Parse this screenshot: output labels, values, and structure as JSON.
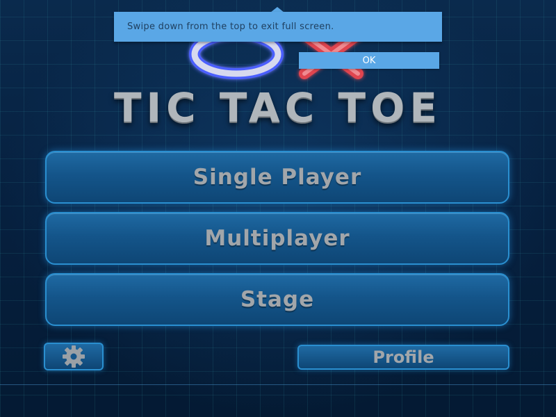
{
  "title": "TIC TAC TOE",
  "logo_icon": "ox-logo",
  "menu": {
    "single_player": "Single Player",
    "multiplayer": "Multiplayer",
    "stage": "Stage"
  },
  "footer": {
    "settings_icon": "gear-icon",
    "profile_label": "Profile"
  },
  "toast": {
    "message": "Swipe down from the top to exit full screen.",
    "ok_label": "OK"
  },
  "colors": {
    "background": "#061a33",
    "button_fill": "#14558a",
    "button_border": "#2a8fd0",
    "button_text": "#a2a6aa",
    "toast_bg": "#5aa7e6",
    "logo_o": "#d7d9ee",
    "logo_x": "#e0454f"
  }
}
